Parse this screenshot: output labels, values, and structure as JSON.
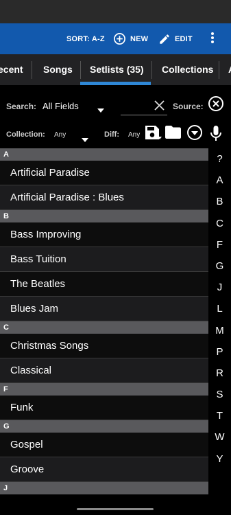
{
  "toolbar": {
    "sort_label": "SORT: A-Z",
    "new_label": "NEW",
    "edit_label": "EDIT"
  },
  "tabs": [
    {
      "label": "ecent"
    },
    {
      "label": "Songs"
    },
    {
      "label": "Setlists (35)"
    },
    {
      "label": "Collections"
    },
    {
      "label": "A"
    }
  ],
  "filters": {
    "search_label": "Search:",
    "search_field": "All Fields",
    "search_value": "",
    "source_label": "Source:",
    "collection_label": "Collection:",
    "collection_value": "Any",
    "diff_label": "Diff:",
    "diff_value": "Any"
  },
  "groups": [
    {
      "header": "A",
      "items": [
        "Artificial Paradise",
        "Artificial Paradise : Blues"
      ]
    },
    {
      "header": "B",
      "items": [
        "Bass Improving",
        "Bass Tuition",
        "The Beatles",
        "Blues Jam"
      ]
    },
    {
      "header": "C",
      "items": [
        "Christmas Songs",
        "Classical"
      ]
    },
    {
      "header": "F",
      "items": [
        "Funk"
      ]
    },
    {
      "header": "G",
      "items": [
        "Gospel",
        "Groove"
      ]
    },
    {
      "header": "J",
      "items": []
    }
  ],
  "index": [
    "?",
    "A",
    "B",
    "C",
    "F",
    "G",
    "J",
    "L",
    "M",
    "P",
    "R",
    "S",
    "T",
    "W",
    "Y"
  ],
  "colors": {
    "toolbar": "#1259ad",
    "tab_indicator": "#2f88d6",
    "section_header": "#59595c"
  },
  "icons": {
    "new": "add-circle-icon",
    "edit": "pencil-icon",
    "more": "more-vert-icon",
    "clear": "close-icon",
    "source": "close-circle-icon",
    "save": "save-icon",
    "folder": "folder-icon",
    "menu": "dropdown-circle-icon",
    "mic": "microphone-icon"
  }
}
